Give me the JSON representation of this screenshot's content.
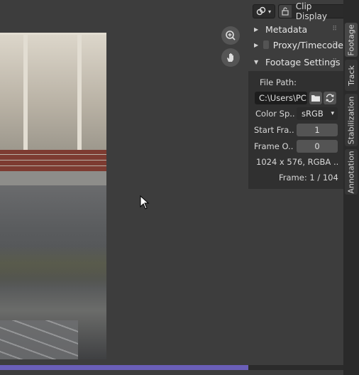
{
  "header": {
    "clip_display_label": "Clip Display",
    "overlay_icon": "link-icon",
    "lock_icon": "lock-icon"
  },
  "viewport": {
    "zoom_icon": "zoom-in-icon",
    "pan_icon": "hand-icon"
  },
  "sections": {
    "metadata": "Metadata",
    "proxy": "Proxy/Timecode",
    "footage_settings": "Footage Settings"
  },
  "footage_settings": {
    "file_path_label": "File Path:",
    "file_path_value": "C:\\Users\\PC..",
    "color_space_label": "Color Sp..",
    "color_space_value": "sRGB",
    "start_frame_label": "Start Fra..",
    "start_frame_value": "1",
    "frame_offset_label": "Frame O..",
    "frame_offset_value": "0",
    "resolution_info": "1024 x 576, RGBA ..",
    "frame_info": "Frame: 1 / 104"
  },
  "tabs": [
    "Footage",
    "Track",
    "Stabilization",
    "Annotation"
  ],
  "colors": {
    "accent_timeline": "#6a5fb8",
    "panel_bg": "#303030"
  }
}
